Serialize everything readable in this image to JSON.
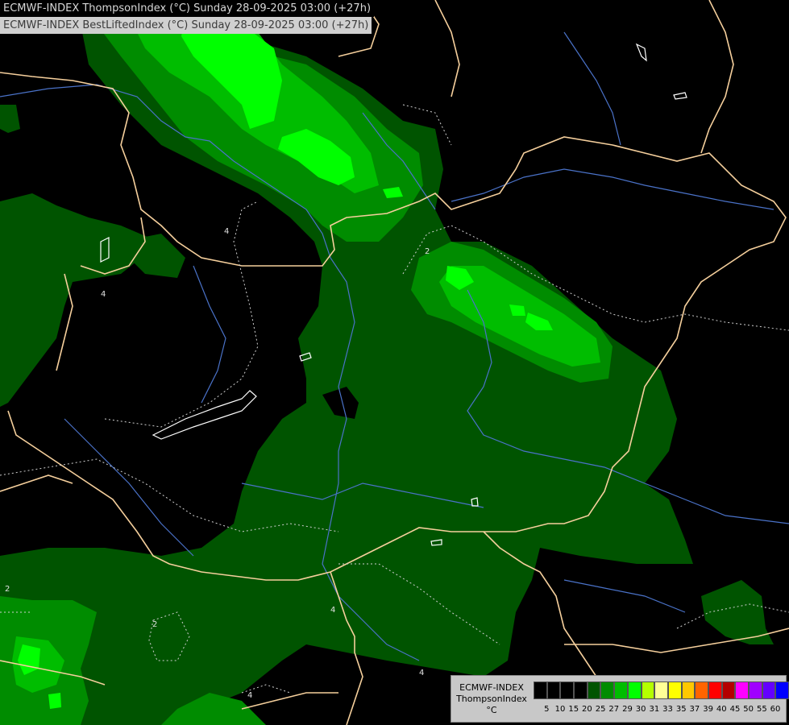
{
  "header": {
    "line1": "ECMWF-INDEX ThompsonIndex (°C) Sunday 28-09-2025 03:00 (+27h)",
    "line2": "ECMWF-INDEX BestLiftedIndex (°C) Sunday 28-09-2025 03:00 (+27h)"
  },
  "legend": {
    "model": "ECMWF-INDEX",
    "parameter": "ThompsonIndex",
    "unit": "°C",
    "ticks": [
      "5",
      "10",
      "15",
      "20",
      "25",
      "27",
      "29",
      "30",
      "31",
      "33",
      "35",
      "37",
      "39",
      "40",
      "45",
      "50",
      "55",
      "60"
    ],
    "colors": [
      "#000000",
      "#000000",
      "#000000",
      "#000000",
      "#005400",
      "#008c00",
      "#00bd00",
      "#00ff00",
      "#b4ff00",
      "#ffff96",
      "#ffff00",
      "#ffc800",
      "#ff6400",
      "#ff0000",
      "#b40000",
      "#ff00ff",
      "#a000ff",
      "#6400ff",
      "#0000ff"
    ]
  },
  "map": {
    "contour_labels": [
      "2",
      "4",
      "4",
      "4",
      "2",
      "4",
      "2",
      "4"
    ],
    "colors": {
      "background": "#000000",
      "dark_green": "#005400",
      "mid_green": "#008c00",
      "bright_green": "#00bd00",
      "lime": "#00ff00",
      "border": "#f5cf9c",
      "river": "#4a72c8",
      "contour": "#d0d0d0"
    }
  }
}
